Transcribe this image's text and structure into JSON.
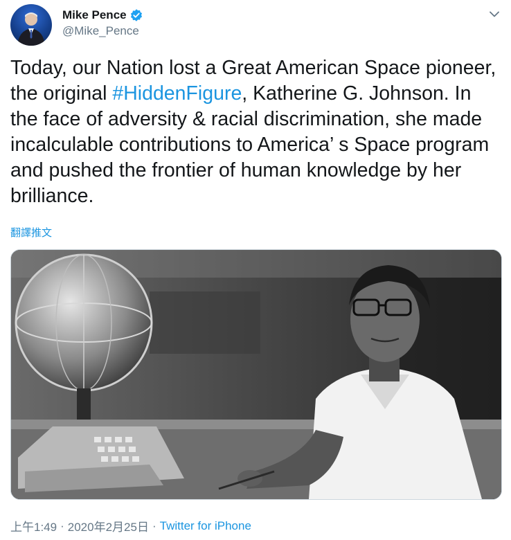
{
  "author": {
    "display_name": "Mike Pence",
    "handle": "@Mike_Pence",
    "verified": true,
    "avatar_icon": "user-avatar"
  },
  "tweet": {
    "text_before": "Today, our Nation lost a Great American Space pioneer, the original ",
    "hashtag": "#HiddenFigure",
    "text_after": ", Katherine G. Johnson. In the face of adversity & racial discrimination, she made incalculable contributions to America’ s Space program and pushed the frontier of human knowledge by her brilliance."
  },
  "translate_label": "翻譯推文",
  "media": {
    "photo_icon": "historical-photo"
  },
  "meta": {
    "time": "上午1:49",
    "separator1": "·",
    "date": "2020年2月25日",
    "separator2": "·",
    "source": "Twitter for iPhone"
  },
  "colors": {
    "link": "#1b95e0",
    "text": "#14171a",
    "muted": "#657786"
  }
}
